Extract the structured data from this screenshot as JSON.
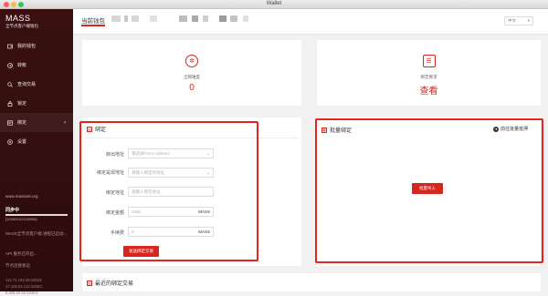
{
  "window": {
    "title": "Wallet"
  },
  "sidebar": {
    "brand_name": "MASS",
    "brand_subtitle": "全节点客户端钱包",
    "items": [
      {
        "label": "我的钱包",
        "icon": "wallet-icon"
      },
      {
        "label": "转帐",
        "icon": "transfer-icon"
      },
      {
        "label": "查询交易",
        "icon": "search-icon"
      },
      {
        "label": "锁定",
        "icon": "lock-icon"
      },
      {
        "label": "绑定",
        "icon": "bind-icon",
        "active": true,
        "has_submenu": true
      },
      {
        "label": "设置",
        "icon": "settings-icon"
      }
    ],
    "website": "www.massnet.org",
    "sync_label": "同步中",
    "sync_value": "[1038293/1038955]",
    "sync_progress": 0.9994,
    "node_message": "MASS全节点客户端 进程已启动...",
    "api_message": "API 服务已开启...",
    "connection_label": "节点连接状态",
    "peers": [
      "112.74.183.29:43453;",
      "47.105.53.132:43453;",
      "8.208.20.82:43453;"
    ]
  },
  "header": {
    "current_wallet_label": "当前钱包",
    "language": "中文",
    "language_icon": "chevron-down-icon"
  },
  "stats": {
    "quota": {
      "label": "全网难度",
      "value": "0",
      "icon": "gear-icon"
    },
    "requirement": {
      "label": "绑定要求",
      "value": "查看",
      "icon": "document-icon"
    }
  },
  "bind_form": {
    "title": "绑定",
    "fields": [
      {
        "label": "转出地址",
        "placeholder": "请选择From Address",
        "type": "select"
      },
      {
        "label": "绑定是现地址",
        "placeholder": "请输入绑定的地址",
        "type": "select"
      },
      {
        "label": "绑定地址",
        "placeholder": "请输入绑定地址",
        "type": "text"
      },
      {
        "label": "绑定金额",
        "placeholder": "1000",
        "unit": "MASS",
        "type": "number"
      },
      {
        "label": "手续费",
        "placeholder": "0",
        "unit": "MASS",
        "type": "number"
      }
    ],
    "submit_label": "发送绑定交易"
  },
  "batch_bind": {
    "title": "批量绑定",
    "link_label": "前往批量抵押",
    "import_label": "批量导入"
  },
  "recent": {
    "title": "最近的绑定交易"
  }
}
